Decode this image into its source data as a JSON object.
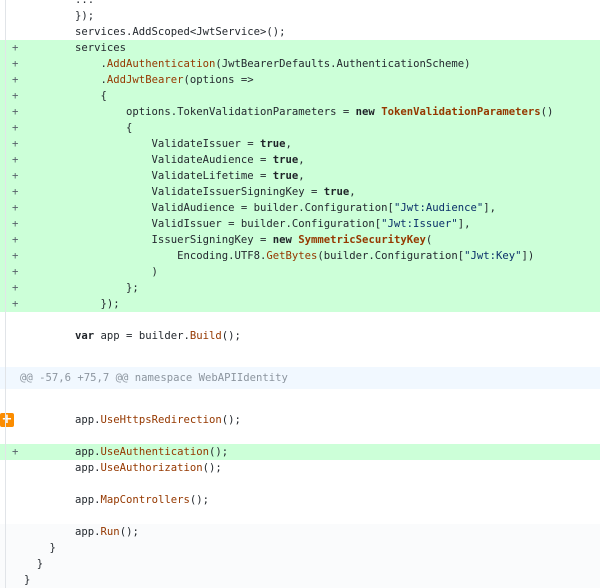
{
  "hunk_header": "@@ -57,6 +75,7 @@ namespace WebAPIIdentity",
  "lines": {
    "l0": "        });",
    "l1": "        services.AddScoped<JwtService>();",
    "a1": "        services",
    "a2_pre": "            .",
    "a2_fn": "AddAuthentication",
    "a2_post": "(JwtBearerDefaults.AuthenticationScheme)",
    "a3_pre": "            .",
    "a3_fn": "AddJwtBearer",
    "a3_post": "(options =>",
    "a4": "            {",
    "a5_pre": "                options.TokenValidationParameters = ",
    "a5_kw": "new",
    "a5_sp": " ",
    "a5_ty": "TokenValidationParameters",
    "a5_post": "()",
    "a6": "                {",
    "a7_pre": "                    ValidateIssuer = ",
    "a7_kw": "true",
    "a7_post": ",",
    "a8_pre": "                    ValidateAudience = ",
    "a8_kw": "true",
    "a8_post": ",",
    "a9_pre": "                    ValidateLifetime = ",
    "a9_kw": "true",
    "a9_post": ",",
    "a10_pre": "                    ValidateIssuerSigningKey = ",
    "a10_kw": "true",
    "a10_post": ",",
    "a11_pre": "                    ValidAudience = builder.Configuration[",
    "a11_str": "\"Jwt:Audience\"",
    "a11_post": "],",
    "a12_pre": "                    ValidIssuer = builder.Configuration[",
    "a12_str": "\"Jwt:Issuer\"",
    "a12_post": "],",
    "a13_pre": "                    IssuerSigningKey = ",
    "a13_kw": "new",
    "a13_sp": " ",
    "a13_ty": "SymmetricSecurityKey",
    "a13_post": "(",
    "a14_pre": "                        Encoding.UTF8.",
    "a14_fn": "GetBytes",
    "a14_mid": "(builder.Configuration[",
    "a14_str": "\"Jwt:Key\"",
    "a14_post": "])",
    "a15": "                    )",
    "a16": "                };",
    "a17": "            });",
    "c1_pre": "        ",
    "c1_kw": "var",
    "c1_mid": " app = builder.",
    "c1_fn": "Build",
    "c1_post": "();",
    "c2_pre": "        app.",
    "c2_fn": "UseHttpsRedirection",
    "c2_post": "();",
    "c3_pre": "        app.",
    "c3_fn": "UseAuthentication",
    "c3_post": "();",
    "c4_pre": "        app.",
    "c4_fn": "UseAuthorization",
    "c4_post": "();",
    "c5_pre": "        app.",
    "c5_fn": "MapControllers",
    "c5_post": "();",
    "c6_pre": "        app.",
    "c6_fn": "Run",
    "c6_post": "();",
    "c7": "    }",
    "c8": "  }",
    "c9": "}"
  },
  "plus": "+",
  "expand_label": "+"
}
